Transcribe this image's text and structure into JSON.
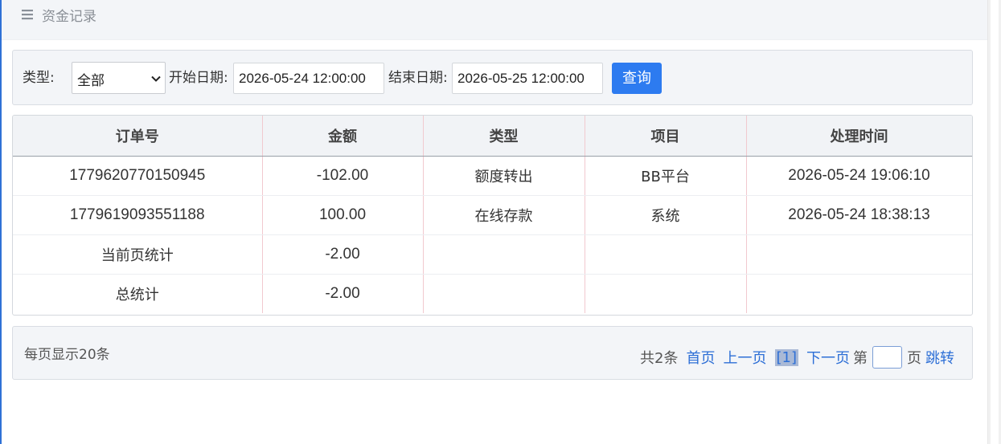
{
  "header": {
    "title": "资金记录",
    "menu_icon": "hamburger-menu-icon"
  },
  "filters": {
    "type_label": "类型:",
    "type_value": "全部",
    "start_label": "开始日期:",
    "start_value": "2026-05-24 12:00:00",
    "end_label": "结束日期:",
    "end_value": "2026-05-25 12:00:00",
    "query_label": "查询"
  },
  "table": {
    "columns": [
      "订单号",
      "金额",
      "类型",
      "项目",
      "处理时间"
    ],
    "rows": [
      [
        "1779620770150945",
        "-102.00",
        "额度转出",
        "BB平台",
        "2026-05-24 19:06:10"
      ],
      [
        "1779619093551188",
        "100.00",
        "在线存款",
        "系统",
        "2026-05-24 18:38:13"
      ]
    ],
    "page_total_label": "当前页统计",
    "page_total_value": "-2.00",
    "grand_total_label": "总统计",
    "grand_total_value": "-2.00"
  },
  "pagination": {
    "page_size_text": "每页显示20条",
    "total_text": "共2条",
    "first": "首页",
    "prev": "上一页",
    "current": "[1]",
    "next": "下一页",
    "page_prefix": "第",
    "page_suffix": "页",
    "jump": "跳转"
  },
  "colors": {
    "accent": "#2d7bf0",
    "link": "#2d6fd6",
    "panel_bg": "#f3f5f8"
  }
}
